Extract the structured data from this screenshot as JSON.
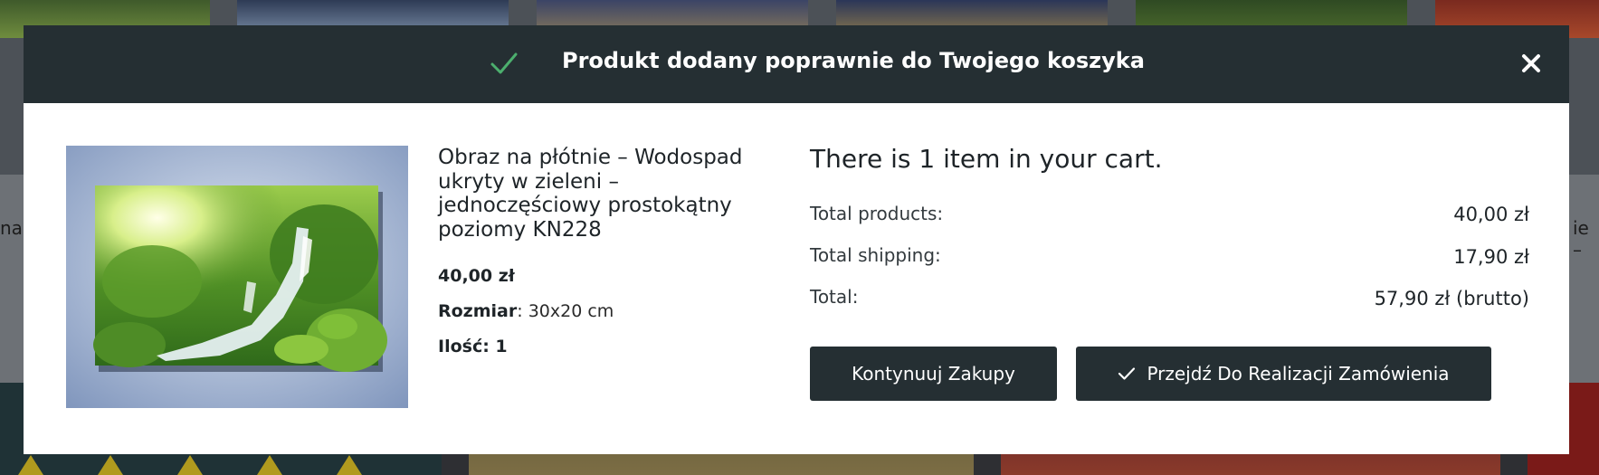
{
  "modal": {
    "header_title": "Produkt dodany poprawnie do Twojego koszyka",
    "check_icon": "check-icon",
    "close_icon": "close-icon",
    "header_bg_color": "#252f33",
    "check_color": "#4caf6e"
  },
  "product": {
    "image_icon": "waterfall-canvas-image",
    "name": "Obraz na płótnie – Wodospad ukryty w zieleni – jednoczęściowy prostokątny poziomy KN228",
    "price": "40,00 zł",
    "size_label": "Rozmiar",
    "size_value": ": 30x20 cm",
    "quantity": "Ilość: 1"
  },
  "cart": {
    "heading": "There is 1 item in your cart.",
    "rows": [
      {
        "label": "Total products:",
        "value": "40,00 zł"
      },
      {
        "label": "Total shipping:",
        "value": "17,90 zł"
      },
      {
        "label": "Total:",
        "value": "57,90 zł (brutto)"
      }
    ]
  },
  "buttons": {
    "continue_label": "Kontynuuj Zakupy",
    "checkout_label": "Przejdź Do Realizacji Zamówienia",
    "button_color": "#252f33"
  },
  "background": {
    "left_edge_text": "na",
    "right_edge_text": "ie –"
  }
}
